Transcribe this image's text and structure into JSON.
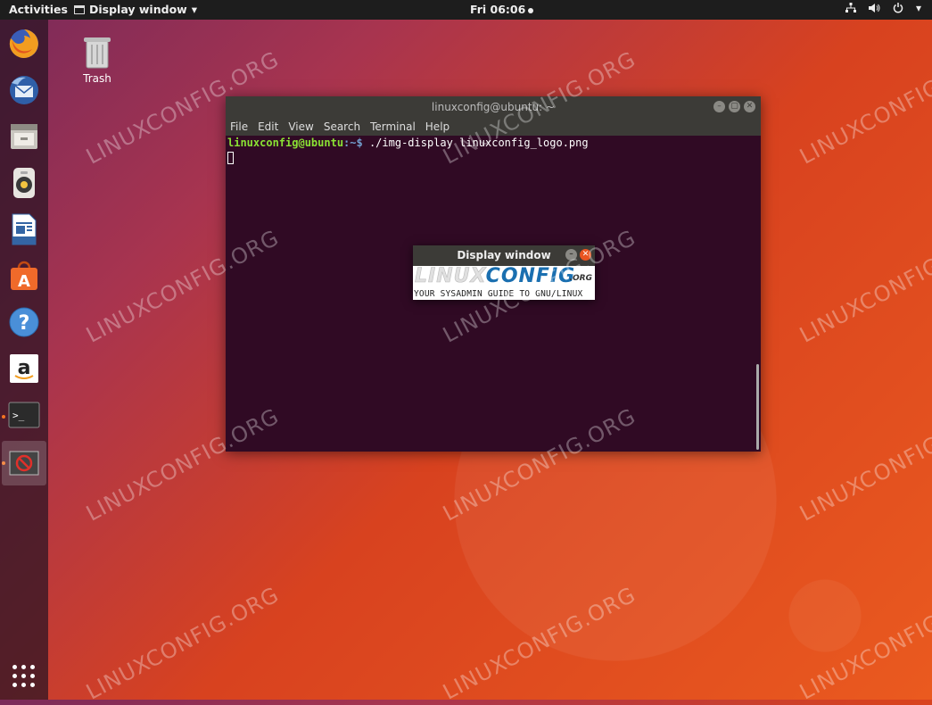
{
  "topbar": {
    "activities": "Activities",
    "app_menu": "Display window",
    "clock": "Fri 06:06"
  },
  "desktop": {
    "trash_label": "Trash"
  },
  "watermark": "LINUXCONFIG.ORG",
  "terminal": {
    "title": "linuxconfig@ubuntu: ~",
    "menu": [
      "File",
      "Edit",
      "View",
      "Search",
      "Terminal",
      "Help"
    ],
    "prompt_user": "linuxconfig@ubuntu",
    "prompt_path": ":~$",
    "command": " ./img-display linuxconfig_logo.png"
  },
  "display_window": {
    "title": "Display window",
    "logo_linux": "LINUX",
    "logo_config": "CONFIG",
    "logo_org": ".ORG",
    "logo_tagline": "YOUR SYSADMIN GUIDE TO GNU/LINUX"
  },
  "dock": {
    "items": [
      "firefox-icon",
      "thunderbird-icon",
      "files-icon",
      "rhythmbox-icon",
      "libreoffice-writer-icon",
      "ubuntu-software-icon",
      "help-icon",
      "amazon-icon",
      "terminal-icon",
      "display-window-icon"
    ]
  },
  "colors": {
    "ubuntu_orange": "#e95420",
    "terminal_bg": "#300a24",
    "prompt_green": "#8ae234",
    "prompt_blue": "#729fcf"
  }
}
